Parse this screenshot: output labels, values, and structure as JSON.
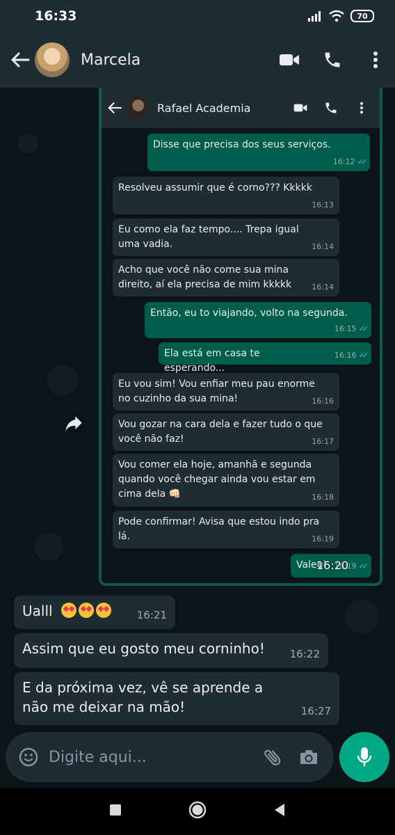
{
  "status_bar": {
    "time": "16:33",
    "battery": "70"
  },
  "header": {
    "contact_name": "Marcela"
  },
  "forwarded_screenshot": {
    "contact_name": "Rafael Academia",
    "messages": [
      {
        "dir": "out",
        "text": "Disse que precisa dos seus serviços.",
        "time": "16:12"
      },
      {
        "dir": "in",
        "text": "Resolveu assumir que é corno??? Kkkkk",
        "time": "16:13"
      },
      {
        "dir": "in",
        "text": "Eu como ela faz tempo.... Trepa igual uma vadia.",
        "time": "16:14"
      },
      {
        "dir": "in",
        "text": "Acho que você não come sua mina direito, aí ela precisa de mim kkkkk",
        "time": "16:14"
      },
      {
        "dir": "out",
        "text": "Então, eu to viajando, volto na segunda.",
        "time": "16:15"
      },
      {
        "dir": "out",
        "text": "Ela está em casa te esperando...",
        "time": "16:16"
      },
      {
        "dir": "in",
        "text": "Eu vou sim! Vou enfiar meu pau enorme no cuzinho da sua mina!",
        "time": "16:16"
      },
      {
        "dir": "in",
        "text": "Vou gozar na cara dela e fazer tudo o que você não faz!",
        "time": "16:17"
      },
      {
        "dir": "in",
        "text": "Vou comer ela hoje, amanhã e segunda quando você chegar ainda vou estar em cima dela 👊🏻",
        "time": "16:18"
      },
      {
        "dir": "in",
        "text": "Pode confirmar! Avisa que estou indo pra lá.",
        "time": "16:19"
      },
      {
        "dir": "out",
        "text": "Valeu!",
        "time": "16:19"
      }
    ]
  },
  "forward_timestamp": "16:20",
  "chat": {
    "messages": [
      {
        "text": "Ualll",
        "time": "16:21"
      },
      {
        "text": "Assim que eu gosto meu corninho!",
        "time": "16:22"
      },
      {
        "text": "E da próxima vez, vê se aprende a não me deixar na mão!",
        "time": "16:27"
      }
    ]
  },
  "input": {
    "placeholder": "Digite aqui..."
  },
  "colors": {
    "header_bg": "#1f2c34",
    "outgoing_bubble": "#005c4b",
    "incoming_bubble": "#1f2c34",
    "accent": "#00a884",
    "read_ticks": "#53bdeb"
  }
}
